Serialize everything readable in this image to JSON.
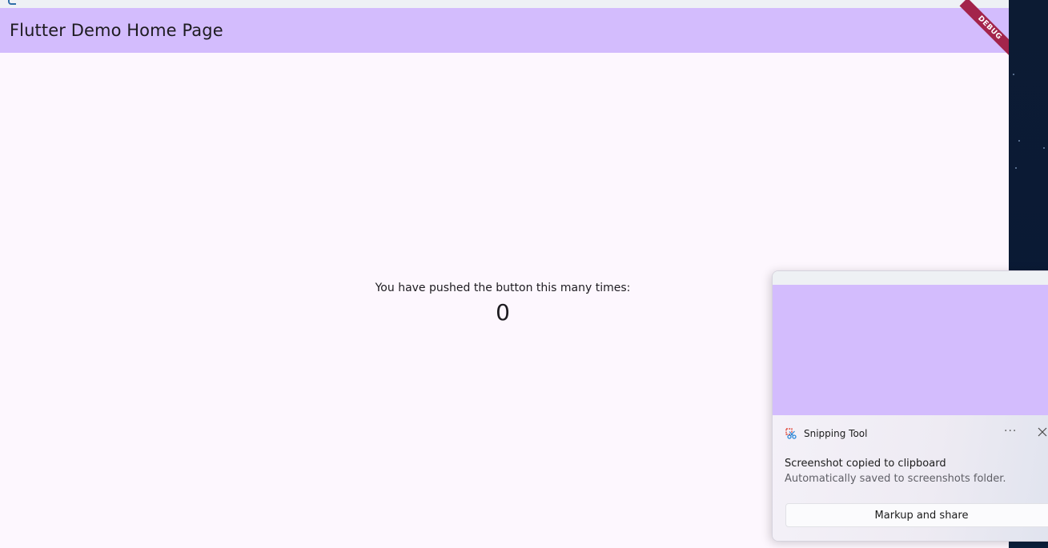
{
  "app": {
    "title": "Flutter Demo Home Page",
    "debug_banner": "DEBUG",
    "message": "You have pushed the button this many times:",
    "counter": "0",
    "colors": {
      "app_bar": "#d3bcfd",
      "background": "#fdf7fe",
      "debug_banner": "#a3244b"
    }
  },
  "notification": {
    "app_name": "Snipping Tool",
    "app_icon": "snipping-tool-icon",
    "more_icon": "more-options-icon",
    "more_glyph": "···",
    "close_icon": "close-icon",
    "heading": "Screenshot copied to clipboard",
    "subtext": "Automatically saved to screenshots folder.",
    "action_label": "Markup and share"
  }
}
